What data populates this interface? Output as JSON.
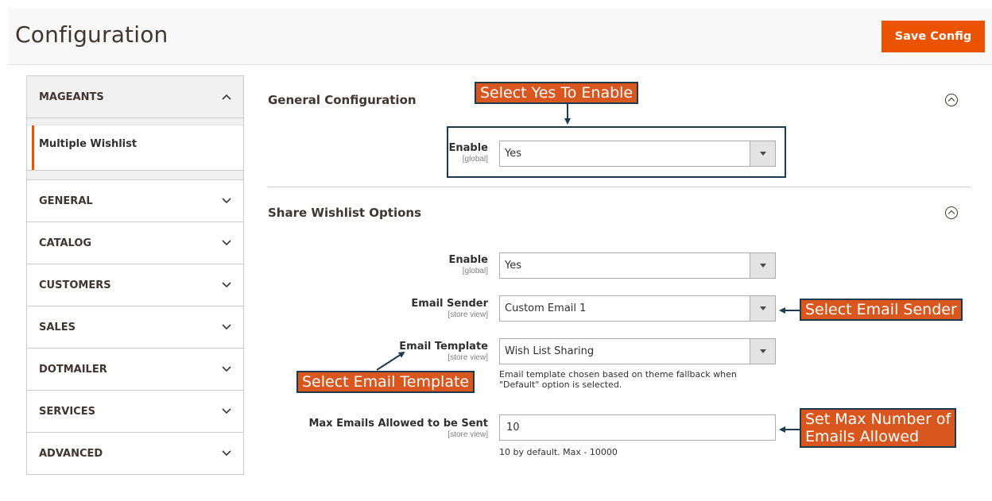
{
  "header": {
    "title": "Configuration",
    "save_label": "Save Config",
    "accent_color": "#eb5202"
  },
  "sidebar": {
    "groups": [
      {
        "label": "MAGEANTS",
        "state": "expanded",
        "icon": "chevron-up-icon"
      },
      {
        "label": "GENERAL",
        "state": "collapsed",
        "icon": "chevron-down-icon"
      },
      {
        "label": "CATALOG",
        "state": "collapsed",
        "icon": "chevron-down-icon"
      },
      {
        "label": "CUSTOMERS",
        "state": "collapsed",
        "icon": "chevron-down-icon"
      },
      {
        "label": "SALES",
        "state": "collapsed",
        "icon": "chevron-down-icon"
      },
      {
        "label": "DOTMAILER",
        "state": "collapsed",
        "icon": "chevron-down-icon"
      },
      {
        "label": "SERVICES",
        "state": "collapsed",
        "icon": "chevron-down-icon"
      },
      {
        "label": "ADVANCED",
        "state": "collapsed",
        "icon": "chevron-down-icon"
      }
    ],
    "active_item": {
      "label": "Multiple Wishlist"
    }
  },
  "sections": {
    "general": {
      "title": "General Configuration",
      "icon": "collapse-circle-icon",
      "enable": {
        "label": "Enable",
        "scope": "[global]",
        "value": "Yes"
      }
    },
    "share": {
      "title": "Share Wishlist Options",
      "icon": "collapse-circle-icon",
      "enable": {
        "label": "Enable",
        "scope": "[global]",
        "value": "Yes"
      },
      "email_sender": {
        "label": "Email Sender",
        "scope": "[store view]",
        "value": "Custom Email 1"
      },
      "email_template": {
        "label": "Email Template",
        "scope": "[store view]",
        "value": "Wish List Sharing",
        "note_line1": "Email template chosen based on theme fallback when",
        "note_line2": "\"Default\" option is selected."
      },
      "max_emails": {
        "label": "Max Emails Allowed to be Sent",
        "scope": "[store view]",
        "value": "10",
        "note": "10 by default. Max - 10000"
      }
    }
  },
  "annotations": {
    "enable": "Select Yes To Enable",
    "sender": "Select Email Sender",
    "template": "Select Email Template",
    "max_line1": "Set Max Number of",
    "max_line2": "Emails Allowed",
    "callout_color": "#d9571e",
    "border_color": "#1d3b4e"
  }
}
